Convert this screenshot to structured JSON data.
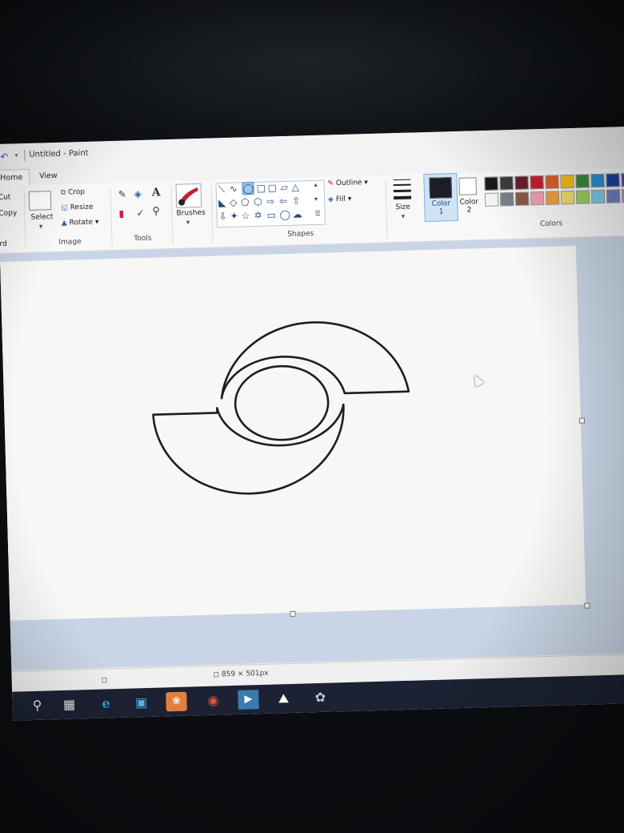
{
  "window": {
    "title": "Untitled - Paint"
  },
  "tabs": [
    {
      "label": "Home"
    },
    {
      "label": "View"
    }
  ],
  "clipboard": {
    "cut_label": "Cut",
    "copy_label": "Copy",
    "paste_partial": "rd"
  },
  "image_group": {
    "label": "Image",
    "select_label": "Select",
    "crop_label": "Crop",
    "resize_label": "Resize",
    "rotate_label": "Rotate"
  },
  "tools_group": {
    "label": "Tools",
    "text_tool_glyph": "A"
  },
  "brushes_group": {
    "label": "Brushes"
  },
  "shapes_group": {
    "label": "Shapes",
    "outline_label": "Outline",
    "fill_label": "Fill"
  },
  "size_group": {
    "label": "Size"
  },
  "colors_group": {
    "label": "Colors",
    "color1_label": "Color 1",
    "color2_label": "Color 2",
    "color1_value": "#1b1d27",
    "color2_value": "#ffffff",
    "palette_row1": [
      "#1b1b1b",
      "#3c3c3c",
      "#6b1f2a",
      "#c8202c",
      "#e0602a",
      "#f0c020",
      "#3a8a3a",
      "#2c8fd0",
      "#1e3fa0",
      "#6a3aa0",
      "#7a7a7a"
    ],
    "palette_row2": [
      "#f5f5f5",
      "#7a7f8a",
      "#8a5a4a",
      "#f0a0b8",
      "#f0a040",
      "#f0e070",
      "#a0d060",
      "#80c8e8",
      "#7080c0",
      "#b090d0",
      "#bdbdbd"
    ]
  },
  "status": {
    "dimensions": "859 × 501px"
  }
}
